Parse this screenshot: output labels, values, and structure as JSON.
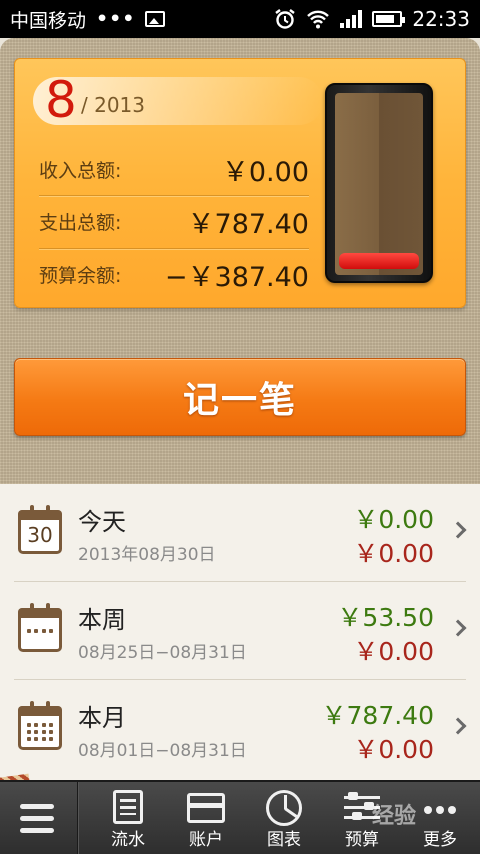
{
  "status_bar": {
    "carrier": "中国移动",
    "dots": "•••",
    "time": "22:33"
  },
  "summary": {
    "month": "8",
    "year": "/ 2013",
    "rows": [
      {
        "label": "收入总额:",
        "value": "￥0.00"
      },
      {
        "label": "支出总额:",
        "value": "￥787.40"
      },
      {
        "label": "预算余额:",
        "value": "−￥387.40"
      }
    ]
  },
  "record_button": {
    "label": "记一笔"
  },
  "periods": [
    {
      "title": "今天",
      "range": "2013年08月30日",
      "income": "￥0.00",
      "expense": "￥0.00",
      "icon": "calendar-day-icon",
      "day": "30"
    },
    {
      "title": "本周",
      "range": "08月25日−08月31日",
      "income": "￥53.50",
      "expense": "￥0.00",
      "icon": "calendar-week-icon"
    },
    {
      "title": "本月",
      "range": "08月01日−08月31日",
      "income": "￥787.40",
      "expense": "￥0.00",
      "icon": "calendar-month-icon"
    }
  ],
  "bottom_nav": {
    "items": [
      {
        "label": "流水",
        "icon": "transactions-icon"
      },
      {
        "label": "账户",
        "icon": "account-card-icon"
      },
      {
        "label": "图表",
        "icon": "pie-chart-icon"
      },
      {
        "label": "预算",
        "icon": "sliders-icon"
      },
      {
        "label": "更多",
        "icon": "more-icon"
      }
    ]
  },
  "watermark": "经验",
  "colors": {
    "income": "#3d7a10",
    "expense": "#a8261c",
    "accent": "#f57a14",
    "month": "#d21a0c"
  }
}
